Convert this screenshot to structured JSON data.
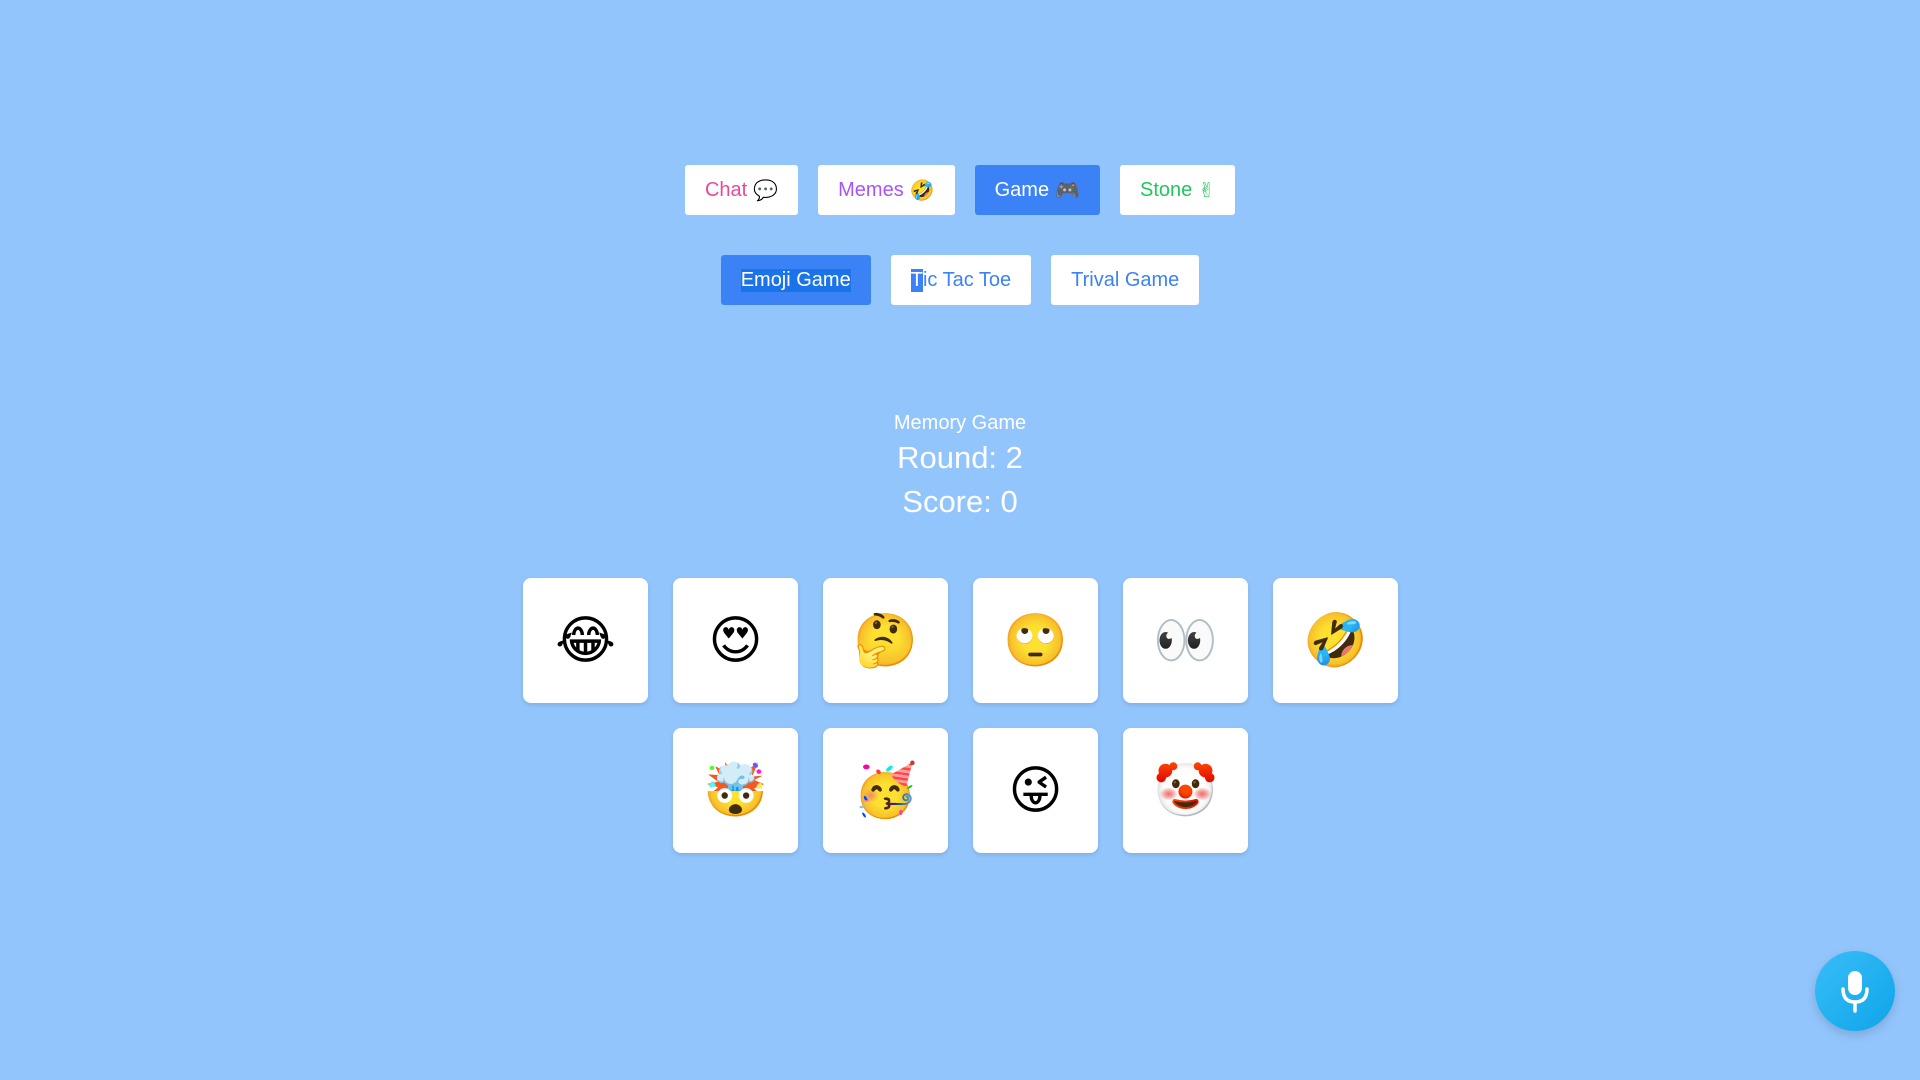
{
  "nav": {
    "tabs": [
      {
        "label": "Chat",
        "emoji": "💬"
      },
      {
        "label": "Memes",
        "emoji": "🤣"
      },
      {
        "label": "Game",
        "emoji": "🎮"
      },
      {
        "label": "Stone",
        "emoji": "✌"
      }
    ],
    "active_tab": "Game"
  },
  "subnav": {
    "tabs": [
      "Emoji Game",
      "Tic Tac Toe",
      "Trival Game"
    ],
    "tic_first_letter": "T",
    "tic_rest": "ic Tac Toe",
    "active_tab": "Emoji Game"
  },
  "game": {
    "title": "Memory Game",
    "round_label": "Round: 2",
    "score_label": "Score: 0",
    "cards": [
      "😂",
      "😍",
      "🤔",
      "🙄",
      "👀",
      "🤣",
      "🤯",
      "🥳",
      "😜",
      "🤡"
    ]
  },
  "colors": {
    "background": "#93c5fd",
    "active": "#3b82f6",
    "chat": "#ec4899",
    "memes": "#a855f7",
    "stone": "#22c55e"
  },
  "icons": {
    "mic": "microphone-icon"
  }
}
